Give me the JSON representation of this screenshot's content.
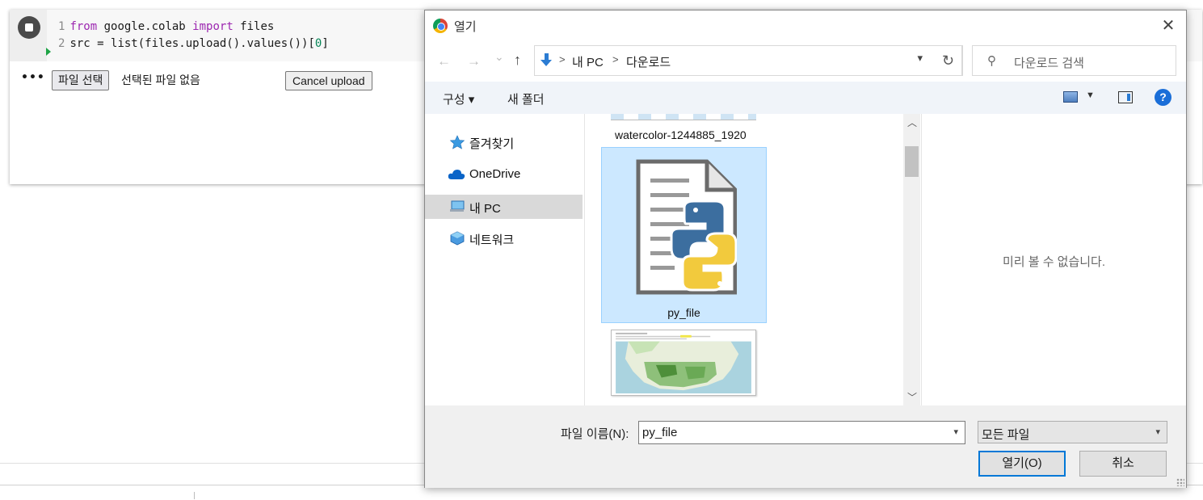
{
  "notebook": {
    "code_lines": [
      {
        "num": "1",
        "kw1": "from",
        "t1": " google.colab ",
        "kw2": "import",
        "t2": " files"
      },
      {
        "num": "2",
        "pre": "src = list(files.upload().values())[",
        "num_lit": "0",
        "post": "]"
      }
    ],
    "output": {
      "dots": "•••",
      "choose_button": "파일 선택",
      "no_file_text": "선택된 파일 없음",
      "cancel_upload": "Cancel upload"
    }
  },
  "dialog": {
    "title": "열기",
    "close": "✕",
    "nav": {
      "back": "←",
      "forward": "→",
      "recent": "⌄",
      "up": "↑"
    },
    "breadcrumb": [
      "내 PC",
      "다운로드"
    ],
    "breadcrumb_sep": ">",
    "refresh": "↻",
    "search_placeholder": "다운로드 검색",
    "toolbar": {
      "organize": "구성 ▾",
      "new_folder": "새 폴더",
      "view_drop": "▼",
      "help": "?"
    },
    "sidebar": [
      {
        "label": "즐겨찾기",
        "icon": "star-icon",
        "selected": false
      },
      {
        "label": "OneDrive",
        "icon": "cloud-icon",
        "selected": false
      },
      {
        "label": "내 PC",
        "icon": "computer-icon",
        "selected": true
      },
      {
        "label": "네트워크",
        "icon": "network-icon",
        "selected": false
      }
    ],
    "files": [
      {
        "name": "watercolor-1244885_1920",
        "selected": false
      },
      {
        "name": "py_file",
        "selected": true
      }
    ],
    "preview_text": "미리 볼 수 없습니다.",
    "filename_label": "파일 이름(N):",
    "filename_value": "py_file",
    "filetype_value": "모든 파일",
    "open_button": "열기(O)",
    "cancel_button": "취소"
  },
  "colors": {
    "keyword": "#9c27b0",
    "number": "#098658",
    "selection": "#cce8ff",
    "accent": "#0078d7"
  }
}
